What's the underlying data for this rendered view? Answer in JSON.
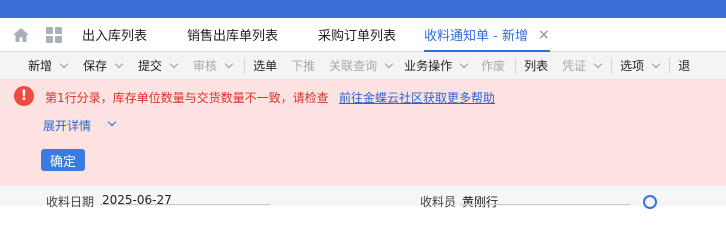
{
  "tabs": [
    {
      "label": "出入库列表"
    },
    {
      "label": "销售出库单列表"
    },
    {
      "label": "采购订单列表"
    },
    {
      "label": "收料通知单 - 新增",
      "active": true,
      "close": "×"
    }
  ],
  "toolbar": {
    "new": "新增",
    "save": "保存",
    "submit": "提交",
    "audit": "审核",
    "select_bill": "选单",
    "push_down": "下推",
    "related_query": "关联查询",
    "business_ops": "业务操作",
    "cancel_bill": "作废",
    "list": "列表",
    "voucher": "凭证",
    "options": "选项",
    "exit_partial": "退"
  },
  "error": {
    "message": "第1行分录，库存单位数量与交货数量不一致，请检查",
    "help_link": "前往金蝶云社区获取更多帮助",
    "expand_details": "展开详情",
    "confirm": "确定"
  },
  "form": {
    "receive_date_label": "收料日期",
    "receive_date_value": "2025-06-27",
    "receiving_org_label": "收料员",
    "receiving_org_value": "黄刚行"
  },
  "colors": {
    "brand_blue": "#3c6fd6",
    "error_bg": "#fde2e2",
    "error_text": "#e0302a",
    "link": "#2f64c8",
    "confirm_bg": "#3a7be0"
  },
  "icons": {
    "home": "home-icon",
    "app_grid": "grid-icon",
    "error": "error-icon"
  }
}
